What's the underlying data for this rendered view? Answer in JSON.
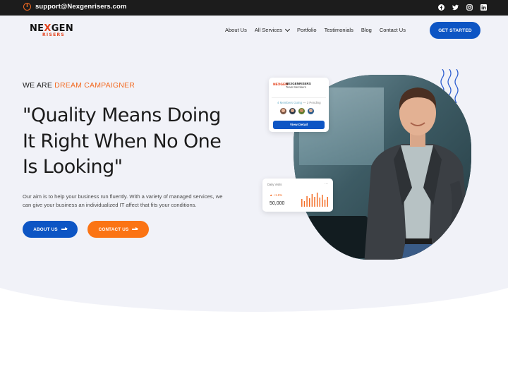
{
  "topbar": {
    "email": "support@Nexgenrisers.com",
    "socials": [
      "facebook-icon",
      "twitter-icon",
      "instagram-icon",
      "linkedin-icon"
    ]
  },
  "brand": {
    "logo_main_pre": "NE",
    "logo_main_x": "X",
    "logo_main_post": "GEN",
    "logo_sub": "RISERS"
  },
  "nav": {
    "items": [
      {
        "label": "About Us"
      },
      {
        "label": "All Services",
        "has_dropdown": true
      },
      {
        "label": "Portfolio"
      },
      {
        "label": "Testimonials"
      },
      {
        "label": "Blog"
      },
      {
        "label": "Contact Us"
      }
    ],
    "cta": "GET STARTED"
  },
  "hero": {
    "kicker_prefix": "WE ARE",
    "kicker_highlight": "DREAM CAMPAIGNER",
    "headline": "\"Quality Means Doing It Right When No One Is Looking\"",
    "description": "Our aim is to help your business run fluently. With a variety of managed services, we can give your business an individualized IT affect that fits your conditions.",
    "btn_about": "ABOUT US",
    "btn_contact": "CONTACT US"
  },
  "team_card": {
    "logo": "NEXGEN",
    "title": "NEXGENRISERS",
    "subtitle": "Team Members",
    "status_going": "4 Members Going",
    "status_sep": " — ",
    "status_pending": "3 Pending",
    "button": "View Detail"
  },
  "visits_card": {
    "title": "Daily Visits",
    "menu": "...",
    "change": "▲ +1.6%",
    "value": "50,000",
    "bars": [
      0.55,
      0.4,
      0.75,
      0.6,
      0.9,
      0.7,
      1.0,
      0.65,
      0.85,
      0.5,
      0.7
    ]
  },
  "colors": {
    "primary": "#0d55c4",
    "accent": "#fb7414",
    "topbar": "#1c1c1c",
    "hero_bg": "#f1f2f8"
  }
}
